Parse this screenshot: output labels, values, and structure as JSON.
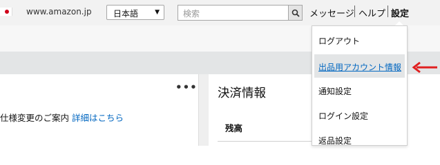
{
  "header": {
    "domain": "www.amazon.jp",
    "language_selected": "日本語",
    "search_placeholder": "検索",
    "messages_label": "メッセージ",
    "help_label": "ヘルプ",
    "settings_label": "設定"
  },
  "widget": {
    "notice_text": "仕様変更のご案内",
    "notice_link": "詳細はこちら"
  },
  "payment": {
    "title": "決済情報",
    "balance_label": "残高"
  },
  "settings_menu": {
    "items": [
      {
        "label": "ログアウト"
      },
      {
        "label": "出品用アカウント情報"
      },
      {
        "label": "通知設定"
      },
      {
        "label": "ログイン設定"
      },
      {
        "label": "返品設定"
      }
    ],
    "highlighted_item": "出品用アカウント情報"
  },
  "colors": {
    "link": "#0066c0",
    "annotation_arrow": "#e02020",
    "topbar_bg": "#f2f2f2",
    "band_gray": "#e3e5e6"
  },
  "icons": [
    "flag-icon",
    "chevron-down-icon",
    "search-icon",
    "more-options-icon",
    "red-arrow-icon"
  ]
}
